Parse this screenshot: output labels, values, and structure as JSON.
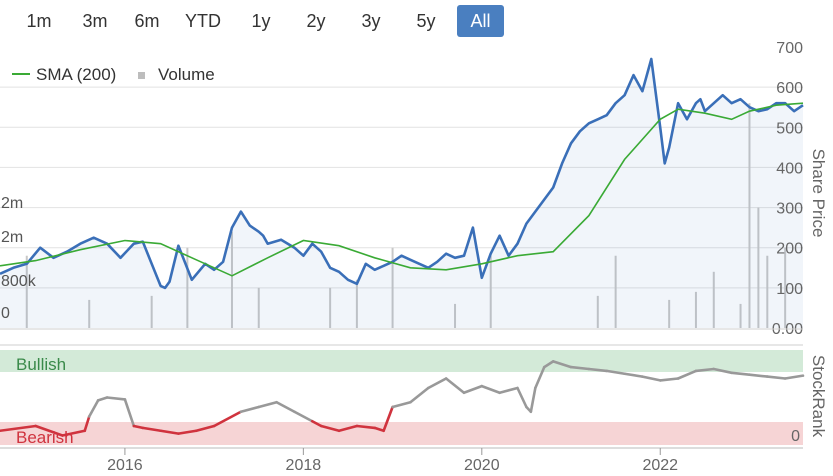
{
  "range_selector": {
    "buttons": [
      "1m",
      "3m",
      "6m",
      "YTD",
      "1y",
      "2y",
      "3y",
      "5y",
      "All"
    ],
    "active": "All"
  },
  "legend": {
    "sma_label": "SMA (200)",
    "volume_label": "Volume"
  },
  "colors": {
    "price": "#3a6fb8",
    "sma": "#3aaa35",
    "volume": "#c8c8c8",
    "bullish_band": "#d3ead8",
    "bearish_band": "#f6d4d5",
    "rank_bull": "#999999",
    "rank_bear": "#d0333e",
    "active_button": "#4a7fc0"
  },
  "chart_data": [
    {
      "type": "line",
      "ylabel": "Share Price",
      "ylim": [
        0,
        700
      ],
      "y_ticks": [
        "0.00",
        "100",
        "200",
        "300",
        "400",
        "500",
        "600",
        "700"
      ],
      "volume_ticks": [
        "0",
        "800k",
        "2m",
        "2m"
      ],
      "x_ticks": [
        "2016",
        "2018",
        "2020",
        "2022"
      ],
      "xlim": [
        2014.6,
        2023.6
      ],
      "grid": true,
      "legend": "top-left",
      "series": [
        {
          "name": "Share Price",
          "x": [
            2014.6,
            2014.75,
            2014.9,
            2015.05,
            2015.2,
            2015.35,
            2015.5,
            2015.65,
            2015.8,
            2015.95,
            2016.1,
            2016.2,
            2016.3,
            2016.4,
            2016.45,
            2016.5,
            2016.6,
            2016.75,
            2016.9,
            2017.0,
            2017.1,
            2017.2,
            2017.3,
            2017.4,
            2017.5,
            2017.55,
            2017.6,
            2017.75,
            2017.9,
            2018.0,
            2018.1,
            2018.2,
            2018.3,
            2018.4,
            2018.5,
            2018.6,
            2018.7,
            2018.8,
            2018.9,
            2019.0,
            2019.1,
            2019.2,
            2019.3,
            2019.4,
            2019.5,
            2019.6,
            2019.7,
            2019.8,
            2019.9,
            2020.0,
            2020.1,
            2020.2,
            2020.3,
            2020.4,
            2020.5,
            2020.6,
            2020.7,
            2020.8,
            2020.9,
            2021.0,
            2021.1,
            2021.2,
            2021.3,
            2021.4,
            2021.5,
            2021.6,
            2021.7,
            2021.8,
            2021.9,
            2022.0,
            2022.05,
            2022.1,
            2022.2,
            2022.3,
            2022.4,
            2022.45,
            2022.5,
            2022.6,
            2022.7,
            2022.8,
            2022.9,
            2023.0,
            2023.1,
            2023.2,
            2023.3,
            2023.4,
            2023.5,
            2023.6
          ],
          "values": [
            135,
            150,
            160,
            200,
            175,
            190,
            210,
            225,
            210,
            175,
            210,
            215,
            160,
            105,
            100,
            115,
            205,
            120,
            160,
            145,
            165,
            250,
            290,
            255,
            240,
            230,
            210,
            220,
            200,
            180,
            210,
            190,
            150,
            140,
            120,
            110,
            160,
            145,
            155,
            165,
            180,
            170,
            160,
            150,
            165,
            185,
            175,
            180,
            250,
            125,
            185,
            230,
            180,
            210,
            260,
            290,
            320,
            350,
            410,
            460,
            490,
            510,
            520,
            530,
            560,
            580,
            630,
            590,
            670,
            500,
            410,
            450,
            560,
            520,
            560,
            570,
            540,
            560,
            580,
            560,
            570,
            550,
            540,
            545,
            560,
            560,
            540,
            555
          ]
        },
        {
          "name": "SMA (200)",
          "x": [
            2014.6,
            2015.0,
            2015.5,
            2016.0,
            2016.4,
            2016.8,
            2017.2,
            2017.6,
            2018.0,
            2018.4,
            2018.8,
            2019.2,
            2019.6,
            2020.0,
            2020.4,
            2020.8,
            2021.2,
            2021.6,
            2022.0,
            2022.2,
            2022.5,
            2022.8,
            2023.0,
            2023.3,
            2023.6
          ],
          "values": [
            155,
            168,
            195,
            218,
            210,
            170,
            130,
            175,
            218,
            205,
            175,
            150,
            145,
            160,
            180,
            190,
            280,
            420,
            520,
            545,
            535,
            520,
            540,
            555,
            560
          ]
        }
      ],
      "volume": {
        "x": [
          2014.9,
          2015.6,
          2016.3,
          2016.7,
          2017.2,
          2017.5,
          2018.3,
          2018.6,
          2019.0,
          2019.7,
          2020.1,
          2021.3,
          2021.5,
          2022.1,
          2022.4,
          2022.6,
          2022.9,
          2023.0,
          2023.1,
          2023.2,
          2023.4
        ],
        "values": [
          0.9,
          0.35,
          0.4,
          1.0,
          1.2,
          0.5,
          0.5,
          0.6,
          1.0,
          0.3,
          0.9,
          0.4,
          0.9,
          0.35,
          0.45,
          0.7,
          0.3,
          2.8,
          1.5,
          0.9,
          1.0
        ],
        "ylim": [
          0,
          3.5
        ]
      }
    },
    {
      "type": "line",
      "ylabel": "StockRank",
      "y_ticks": [
        "0"
      ],
      "bands": [
        "Bullish",
        "Bearish"
      ],
      "ylim": [
        0,
        100
      ],
      "series": [
        {
          "name": "StockRank",
          "x": [
            2014.6,
            2015.0,
            2015.3,
            2015.55,
            2015.6,
            2015.7,
            2015.8,
            2016.0,
            2016.1,
            2016.2,
            2016.4,
            2016.6,
            2016.8,
            2017.0,
            2017.3,
            2017.5,
            2017.7,
            2017.9,
            2018.1,
            2018.2,
            2018.4,
            2018.6,
            2018.8,
            2018.9,
            2019.0,
            2019.2,
            2019.4,
            2019.6,
            2019.8,
            2020.0,
            2020.2,
            2020.4,
            2020.5,
            2020.55,
            2020.6,
            2020.7,
            2020.8,
            2021.0,
            2021.2,
            2021.4,
            2021.6,
            2021.8,
            2022.0,
            2022.2,
            2022.4,
            2022.6,
            2022.8,
            2023.0,
            2023.2,
            2023.4,
            2023.6
          ],
          "values": [
            15,
            20,
            10,
            15,
            30,
            47,
            50,
            48,
            20,
            18,
            15,
            12,
            15,
            20,
            35,
            40,
            45,
            35,
            25,
            20,
            15,
            20,
            18,
            15,
            40,
            45,
            60,
            70,
            55,
            62,
            55,
            60,
            40,
            35,
            60,
            82,
            88,
            82,
            80,
            78,
            75,
            72,
            68,
            70,
            78,
            80,
            76,
            74,
            72,
            70,
            73
          ],
          "threshold": 30
        }
      ]
    }
  ]
}
